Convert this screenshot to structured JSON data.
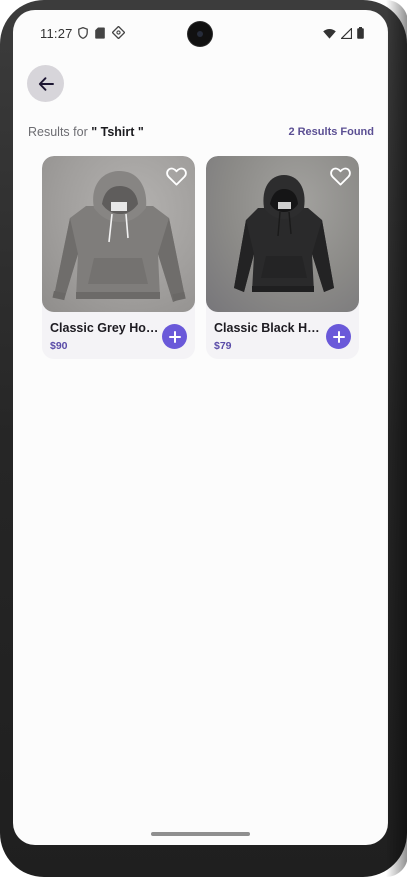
{
  "status_bar": {
    "time": "11:27",
    "left_icons": [
      "shield-icon",
      "sd-card-icon",
      "vpn-key-icon"
    ],
    "right_icons": [
      "wifi-icon",
      "cell-signal-icon",
      "battery-icon"
    ]
  },
  "header": {
    "back_icon": "arrow-left-icon",
    "results_prefix": "Results for",
    "query": "\" Tshirt \"",
    "results_count": "2 Results Found"
  },
  "products": [
    {
      "name": "Classic Grey Hoodie",
      "price": "$90",
      "image": "grey-hoodie-photo",
      "favorite_icon": "heart-outline-icon",
      "add_icon": "plus-icon"
    },
    {
      "name": "Classic Black Hoodie",
      "price": "$79",
      "image": "black-hoodie-photo",
      "favorite_icon": "heart-outline-icon",
      "add_icon": "plus-icon"
    }
  ],
  "colors": {
    "accent": "#6a59d9",
    "price": "#5a4ca8",
    "results_count": "#5b4f93",
    "back_button_bg": "#d7d5da"
  }
}
